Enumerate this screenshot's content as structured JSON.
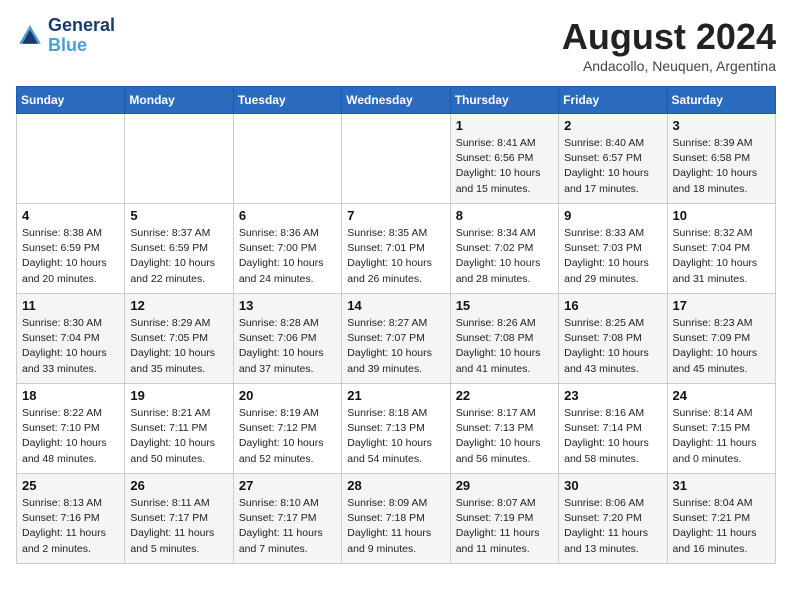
{
  "header": {
    "logo_line1": "General",
    "logo_line2": "Blue",
    "month_title": "August 2024",
    "subtitle": "Andacollo, Neuquen, Argentina"
  },
  "weekdays": [
    "Sunday",
    "Monday",
    "Tuesday",
    "Wednesday",
    "Thursday",
    "Friday",
    "Saturday"
  ],
  "weeks": [
    [
      {
        "day": "",
        "info": ""
      },
      {
        "day": "",
        "info": ""
      },
      {
        "day": "",
        "info": ""
      },
      {
        "day": "",
        "info": ""
      },
      {
        "day": "1",
        "info": "Sunrise: 8:41 AM\nSunset: 6:56 PM\nDaylight: 10 hours\nand 15 minutes."
      },
      {
        "day": "2",
        "info": "Sunrise: 8:40 AM\nSunset: 6:57 PM\nDaylight: 10 hours\nand 17 minutes."
      },
      {
        "day": "3",
        "info": "Sunrise: 8:39 AM\nSunset: 6:58 PM\nDaylight: 10 hours\nand 18 minutes."
      }
    ],
    [
      {
        "day": "4",
        "info": "Sunrise: 8:38 AM\nSunset: 6:59 PM\nDaylight: 10 hours\nand 20 minutes."
      },
      {
        "day": "5",
        "info": "Sunrise: 8:37 AM\nSunset: 6:59 PM\nDaylight: 10 hours\nand 22 minutes."
      },
      {
        "day": "6",
        "info": "Sunrise: 8:36 AM\nSunset: 7:00 PM\nDaylight: 10 hours\nand 24 minutes."
      },
      {
        "day": "7",
        "info": "Sunrise: 8:35 AM\nSunset: 7:01 PM\nDaylight: 10 hours\nand 26 minutes."
      },
      {
        "day": "8",
        "info": "Sunrise: 8:34 AM\nSunset: 7:02 PM\nDaylight: 10 hours\nand 28 minutes."
      },
      {
        "day": "9",
        "info": "Sunrise: 8:33 AM\nSunset: 7:03 PM\nDaylight: 10 hours\nand 29 minutes."
      },
      {
        "day": "10",
        "info": "Sunrise: 8:32 AM\nSunset: 7:04 PM\nDaylight: 10 hours\nand 31 minutes."
      }
    ],
    [
      {
        "day": "11",
        "info": "Sunrise: 8:30 AM\nSunset: 7:04 PM\nDaylight: 10 hours\nand 33 minutes."
      },
      {
        "day": "12",
        "info": "Sunrise: 8:29 AM\nSunset: 7:05 PM\nDaylight: 10 hours\nand 35 minutes."
      },
      {
        "day": "13",
        "info": "Sunrise: 8:28 AM\nSunset: 7:06 PM\nDaylight: 10 hours\nand 37 minutes."
      },
      {
        "day": "14",
        "info": "Sunrise: 8:27 AM\nSunset: 7:07 PM\nDaylight: 10 hours\nand 39 minutes."
      },
      {
        "day": "15",
        "info": "Sunrise: 8:26 AM\nSunset: 7:08 PM\nDaylight: 10 hours\nand 41 minutes."
      },
      {
        "day": "16",
        "info": "Sunrise: 8:25 AM\nSunset: 7:08 PM\nDaylight: 10 hours\nand 43 minutes."
      },
      {
        "day": "17",
        "info": "Sunrise: 8:23 AM\nSunset: 7:09 PM\nDaylight: 10 hours\nand 45 minutes."
      }
    ],
    [
      {
        "day": "18",
        "info": "Sunrise: 8:22 AM\nSunset: 7:10 PM\nDaylight: 10 hours\nand 48 minutes."
      },
      {
        "day": "19",
        "info": "Sunrise: 8:21 AM\nSunset: 7:11 PM\nDaylight: 10 hours\nand 50 minutes."
      },
      {
        "day": "20",
        "info": "Sunrise: 8:19 AM\nSunset: 7:12 PM\nDaylight: 10 hours\nand 52 minutes."
      },
      {
        "day": "21",
        "info": "Sunrise: 8:18 AM\nSunset: 7:13 PM\nDaylight: 10 hours\nand 54 minutes."
      },
      {
        "day": "22",
        "info": "Sunrise: 8:17 AM\nSunset: 7:13 PM\nDaylight: 10 hours\nand 56 minutes."
      },
      {
        "day": "23",
        "info": "Sunrise: 8:16 AM\nSunset: 7:14 PM\nDaylight: 10 hours\nand 58 minutes."
      },
      {
        "day": "24",
        "info": "Sunrise: 8:14 AM\nSunset: 7:15 PM\nDaylight: 11 hours\nand 0 minutes."
      }
    ],
    [
      {
        "day": "25",
        "info": "Sunrise: 8:13 AM\nSunset: 7:16 PM\nDaylight: 11 hours\nand 2 minutes."
      },
      {
        "day": "26",
        "info": "Sunrise: 8:11 AM\nSunset: 7:17 PM\nDaylight: 11 hours\nand 5 minutes."
      },
      {
        "day": "27",
        "info": "Sunrise: 8:10 AM\nSunset: 7:17 PM\nDaylight: 11 hours\nand 7 minutes."
      },
      {
        "day": "28",
        "info": "Sunrise: 8:09 AM\nSunset: 7:18 PM\nDaylight: 11 hours\nand 9 minutes."
      },
      {
        "day": "29",
        "info": "Sunrise: 8:07 AM\nSunset: 7:19 PM\nDaylight: 11 hours\nand 11 minutes."
      },
      {
        "day": "30",
        "info": "Sunrise: 8:06 AM\nSunset: 7:20 PM\nDaylight: 11 hours\nand 13 minutes."
      },
      {
        "day": "31",
        "info": "Sunrise: 8:04 AM\nSunset: 7:21 PM\nDaylight: 11 hours\nand 16 minutes."
      }
    ]
  ]
}
